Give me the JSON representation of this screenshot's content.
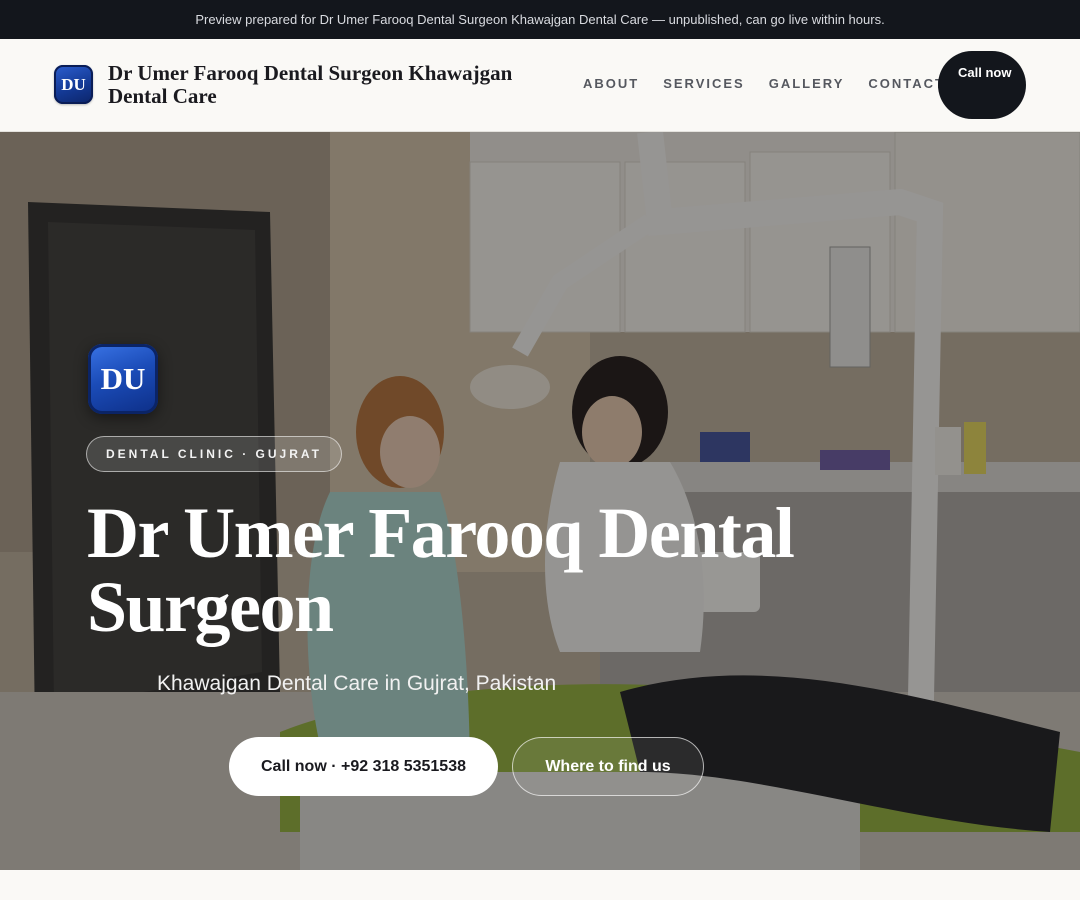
{
  "preview_banner": "Preview prepared for Dr Umer Farooq Dental Surgeon Khawajgan Dental Care — unpublished, can go live within hours.",
  "header": {
    "logo_initials": "DU",
    "brand_name": "Dr Umer Farooq Dental Surgeon Khawajgan Dental Care",
    "nav": [
      "ABOUT",
      "SERVICES",
      "GALLERY",
      "CONTACT"
    ],
    "call_button": "Call now"
  },
  "hero": {
    "logo_initials": "DU",
    "eyebrow": "DENTAL CLINIC · GUJRAT",
    "title": "Dr Umer Farooq Dental Surgeon",
    "subtitle": "Khawajgan Dental Care in Gujrat, Pakistan",
    "primary_button": "Call now · +92 318 5351538",
    "secondary_button": "Where to find us"
  },
  "colors": {
    "dark": "#13161c",
    "brand_blue": "#1b4cb8",
    "page_bg": "#faf9f6"
  }
}
